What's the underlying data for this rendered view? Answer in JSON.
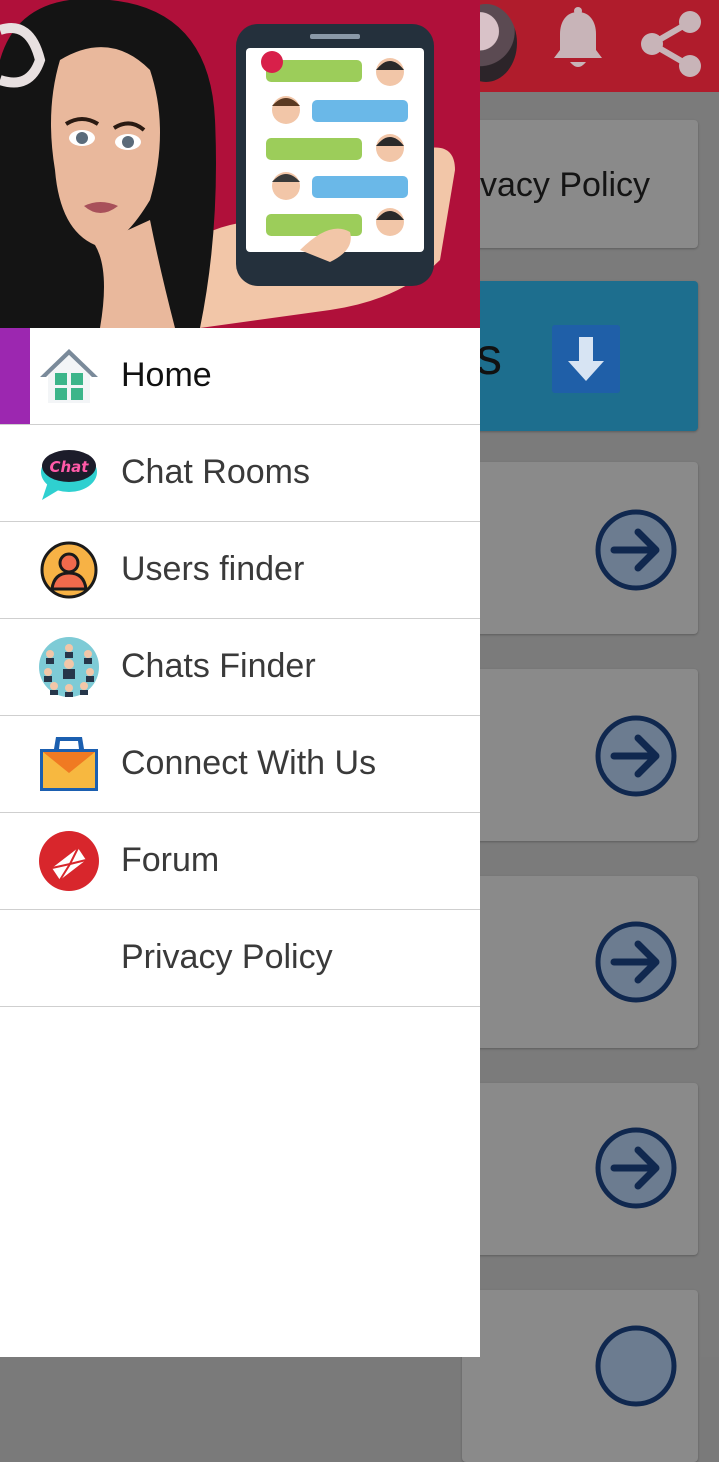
{
  "background": {
    "card_text": "vacy Policy",
    "banner_letter": "s"
  },
  "drawer": {
    "items": [
      {
        "label": "Home",
        "icon": "home-icon",
        "active": true
      },
      {
        "label": "Chat Rooms",
        "icon": "chat-bubble-icon"
      },
      {
        "label": "Users finder",
        "icon": "user-icon"
      },
      {
        "label": "Chats Finder",
        "icon": "people-network-icon"
      },
      {
        "label": "Connect With Us",
        "icon": "envelope-icon"
      },
      {
        "label": "Forum",
        "icon": "mail-badge-icon"
      },
      {
        "label": "Privacy Policy",
        "icon": null
      }
    ],
    "chat_icon_text": "Chat"
  },
  "colors": {
    "header_red": "#b0103a",
    "active_accent": "#9c27b0",
    "topbar_red": "#b01c2c",
    "banner_blue": "#1d6e8e"
  }
}
